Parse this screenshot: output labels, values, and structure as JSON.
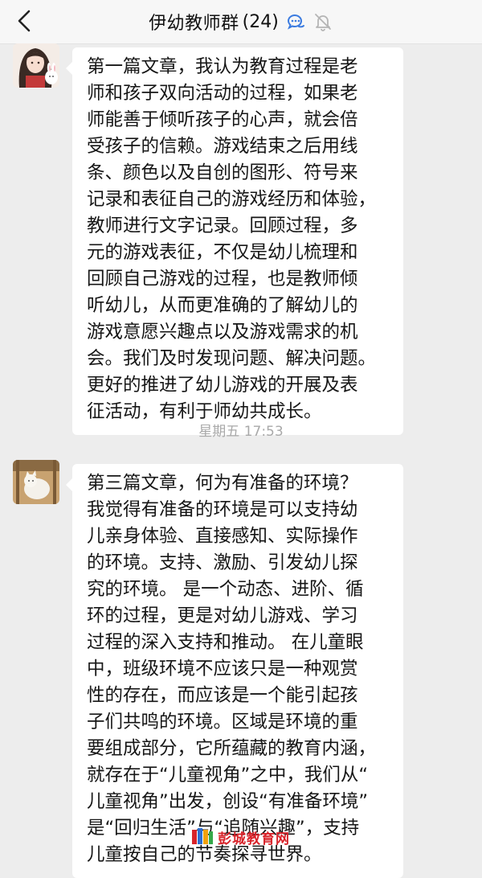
{
  "header": {
    "title": "伊幼教师群",
    "count": "(24)",
    "back_icon": "back-chevron-icon",
    "group_icon": "chat-bubbles-icon",
    "mute_icon": "bell-muted-icon"
  },
  "messages": [
    {
      "lines": [
        "第一篇文章，我认为教育过程是老",
        "师和孩子双向活动的过程，如果老",
        "师能善于倾听孩子的心声，就会倍",
        "受孩子的信赖。游戏结束之后用线",
        "条、颜色以及自创的图形、符号来",
        "记录和表征自己的游戏经历和体验，",
        "教师进行文字记录。回顾过程，多",
        "元的游戏表征，不仅是幼儿梳理和",
        "回顾自己游戏的过程，也是教师倾",
        "听幼儿，从而更准确的了解幼儿的",
        "游戏意愿兴趣点以及游戏需求的机",
        "会。我们及时发现问题、解决问题。",
        "更好的推进了幼儿游戏的开展及表",
        "征活动，有利于师幼共成长。"
      ]
    },
    {
      "lines": [
        "第三篇文章，何为有准备的环境？",
        "我觉得有准备的环境是可以支持幼",
        "儿亲身体验、直接感知、实际操作",
        "的环境。支持、激励、引发幼儿探",
        "究的环境。 是一个动态、进阶、循",
        "环的过程，更是对幼儿游戏、学习",
        "过程的深入支持和推动。 在儿童眼",
        "中，班级环境不应该只是一种观赏",
        "性的存在，而应该是一个能引起孩",
        "子们共鸣的环境。区域是环境的重",
        "要组成部分，它所蕴藏的教育内涵，",
        "就存在于“儿童视角”之中，我们从“",
        "儿童视角”出发，创设“有准备环境”",
        "是“回归生活”与“追随兴趣”，支持",
        "儿童按自己的节奏探寻世界。"
      ]
    }
  ],
  "timestamp": "星期五 17:53",
  "watermark": {
    "text": "彭城教育网",
    "sub": "www.pcjyw.cn",
    "colors": [
      "#d8232a",
      "#2f6fd1",
      "#f2a20c",
      "#35a84a"
    ]
  }
}
